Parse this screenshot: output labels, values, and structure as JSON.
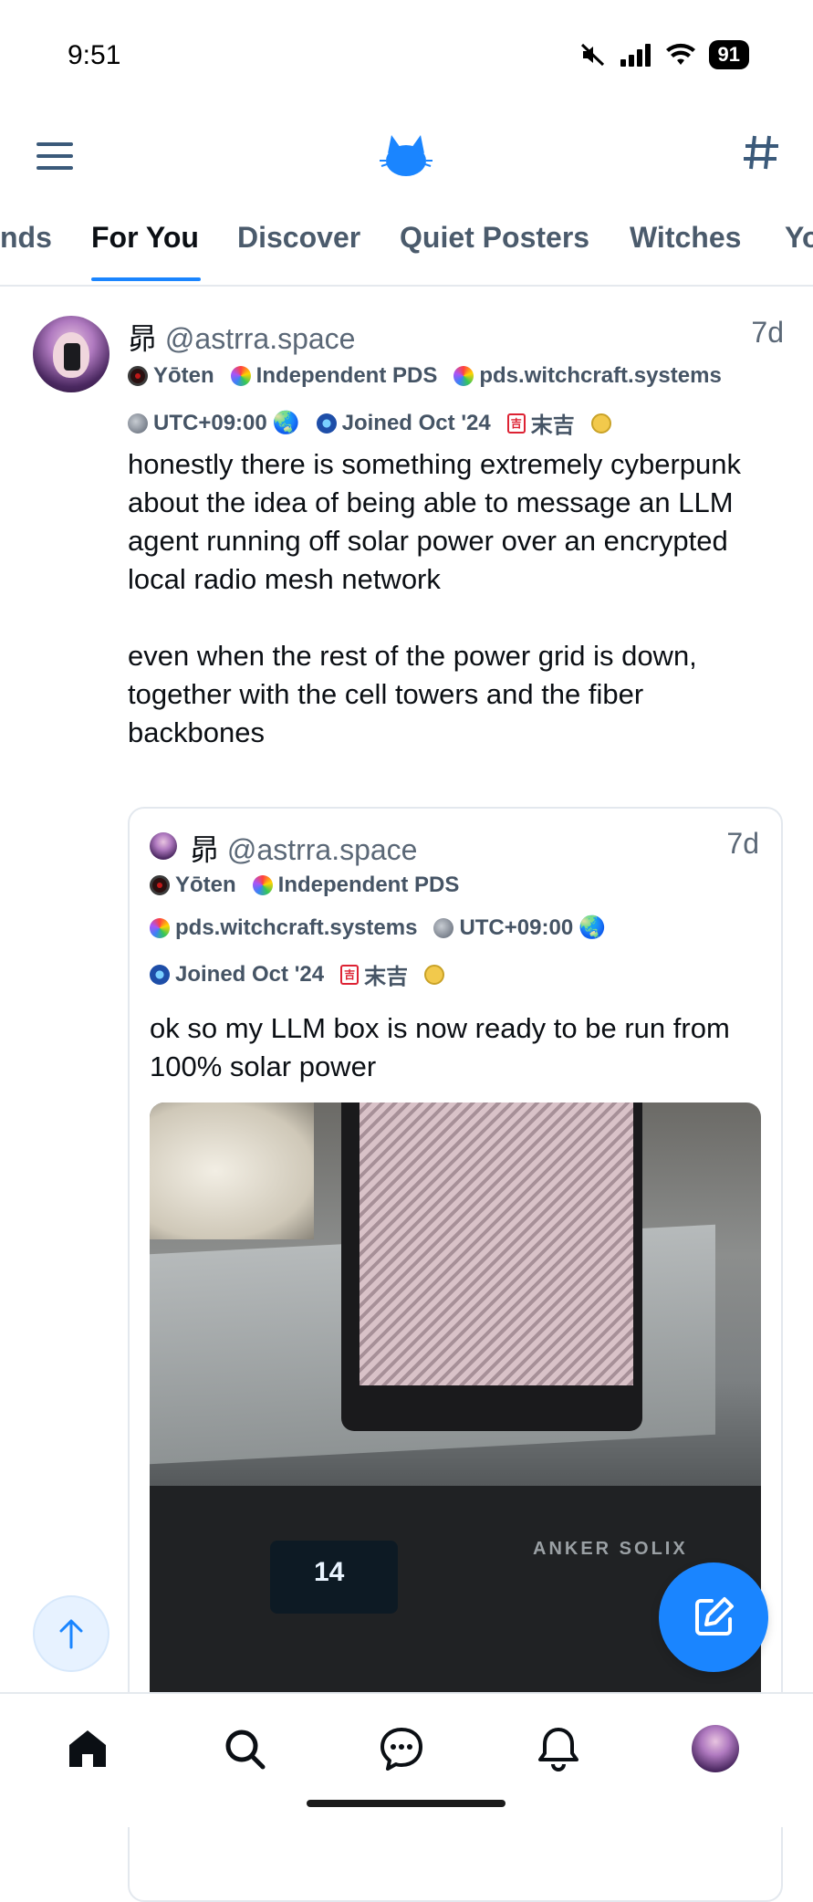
{
  "status_bar": {
    "time": "9:51",
    "battery": "91"
  },
  "tabs": [
    "nds",
    "For You",
    "Discover",
    "Quiet Posters",
    "Witches",
    "Yo"
  ],
  "post": {
    "display_name": "昴",
    "handle": "@astrra.space",
    "time": "7d",
    "badges": {
      "yoten": "Yōten",
      "independent_pds": "Independent PDS",
      "pds_host": "pds.witchcraft.systems",
      "utc": "UTC+09:00",
      "joined": "Joined Oct '24",
      "fortune": "末吉"
    },
    "paragraph1": "honestly there is something extremely cyberpunk about the idea of being able to message an LLM agent running off solar power over an encrypted local radio mesh network",
    "paragraph2": "even when the rest of the power grid is down, together with the cell towers and the fiber backbones"
  },
  "quote": {
    "display_name": "昴",
    "handle": "@astrra.space",
    "time": "7d",
    "badges": {
      "yoten": "Yōten",
      "independent_pds": "Independent PDS",
      "pds_host": "pds.witchcraft.systems",
      "utc": "UTC+09:00",
      "joined": "Joined Oct '24",
      "fortune": "末吉"
    },
    "text": "ok so my LLM box is now ready to be run from 100% solar power",
    "image": {
      "screen_reading": "14",
      "brand_text": "ANKER SOLIX"
    }
  },
  "colors": {
    "accent": "#1a85ff",
    "badge_text": "#455465",
    "muted": "#5b6877"
  }
}
